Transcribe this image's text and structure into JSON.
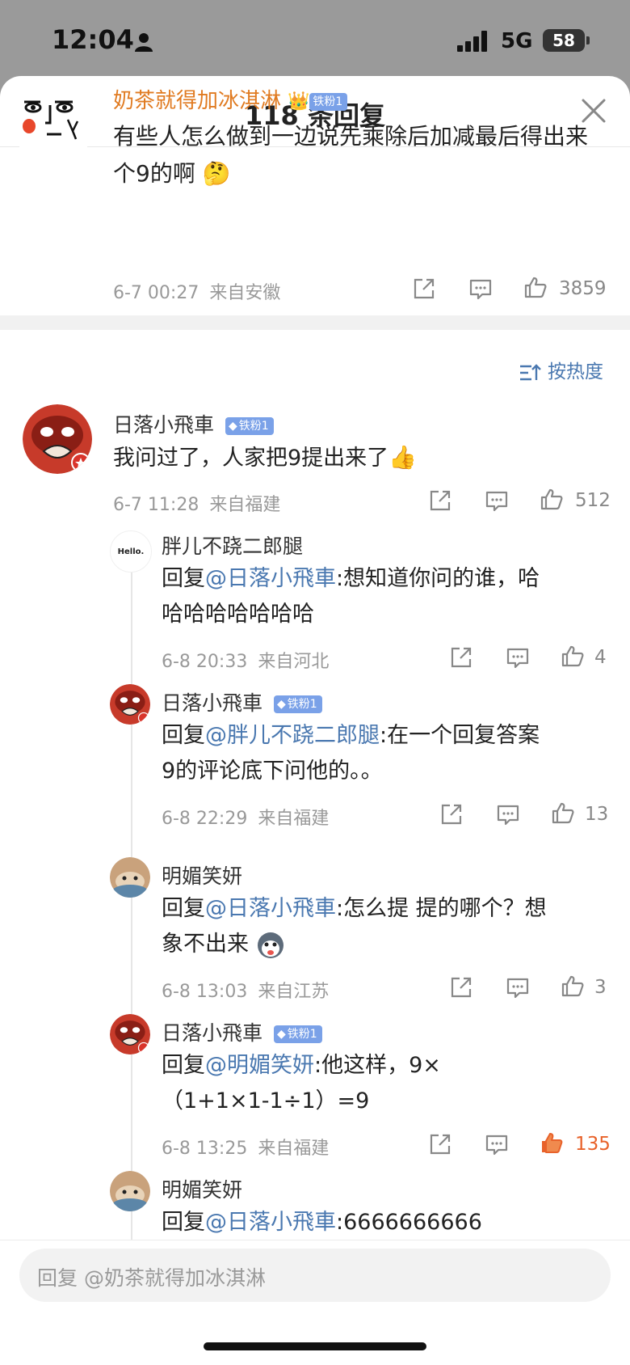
{
  "status_bar": {
    "time": "12:04",
    "network": "5G",
    "battery": "58"
  },
  "header": {
    "title": "118 条回复"
  },
  "main_comment": {
    "user": "奶茶就得加冰淇淋",
    "badge": "铁粉1",
    "text": "有些人怎么做到一边说先乘除后加减最后得出来个9的啊",
    "emoji": "🤔",
    "time": "6-7 00:27",
    "location": "来自安徽",
    "likes": "3859"
  },
  "sort": {
    "label": "按热度"
  },
  "replies": [
    {
      "user": "日落小飛車",
      "badge": "铁粉1",
      "text": "我问过了，人家把9提出来了",
      "emoji": "👍",
      "time": "6-7 11:28",
      "location": "来自福建",
      "likes": "512"
    },
    {
      "user": "胖儿不跷二郎腿",
      "avatar_text": "Hello.",
      "prefix": "回复",
      "mention": "@日落小飛車",
      "text": ":想知道你问的谁，哈",
      "text2": "哈哈哈哈哈哈哈",
      "time": "6-8 20:33",
      "location": "来自河北",
      "likes": "4"
    },
    {
      "user": "日落小飛車",
      "badge": "铁粉1",
      "prefix": "回复",
      "mention": "@胖儿不跷二郎腿",
      "text": ":在一个回复答案",
      "text2": "9的评论底下问他的。。",
      "time": "6-8 22:29",
      "location": "来自福建",
      "likes": "13"
    },
    {
      "user": "明媚笑妍",
      "prefix": "回复",
      "mention": "@日落小飛車",
      "text": ":怎么提 提的哪个？想",
      "text2": "象不出来",
      "time": "6-8 13:03",
      "location": "来自江苏",
      "likes": "3"
    },
    {
      "user": "日落小飛車",
      "badge": "铁粉1",
      "prefix": "回复",
      "mention": "@明媚笑妍",
      "text": ":他这样，9×",
      "text2": "（1+1×1-1÷1）=9",
      "time": "6-8 13:25",
      "location": "来自福建",
      "likes": "135"
    },
    {
      "user": "明媚笑妍",
      "prefix": "回复",
      "mention": "@日落小飛車",
      "text": ":6666666666"
    }
  ],
  "input": {
    "placeholder": "回复 @奶茶就得加冰淇淋"
  },
  "colors": {
    "accent": "#4a78b0",
    "liked": "#e8622a",
    "username_main": "#e07a20"
  }
}
